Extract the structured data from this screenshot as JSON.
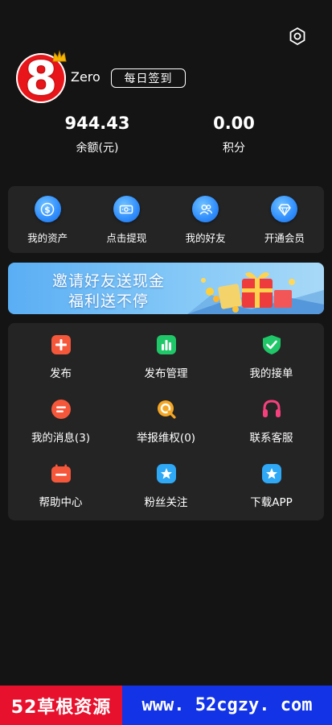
{
  "header": {
    "settings_icon": "settings-gear-icon",
    "avatar_digit": "8",
    "username": "Zero",
    "checkin_label": "每日签到"
  },
  "stats": {
    "balance_value": "944.43",
    "balance_label": "余额(元)",
    "points_value": "0.00",
    "points_label": "积分"
  },
  "quick_actions": [
    {
      "label": "我的资产",
      "icon": "dollar-coin-icon"
    },
    {
      "label": "点击提现",
      "icon": "cash-bill-icon"
    },
    {
      "label": "我的好友",
      "icon": "friends-icon"
    },
    {
      "label": "开通会员",
      "icon": "diamond-icon"
    }
  ],
  "banner": {
    "line1": "邀请好友送现金",
    "line2": "福利送不停"
  },
  "menu": [
    {
      "label": "发布",
      "icon": "plus-icon",
      "color": "#f5573b"
    },
    {
      "label": "发布管理",
      "icon": "bar-chart-icon",
      "color": "#1fc768"
    },
    {
      "label": "我的接单",
      "icon": "shield-check-icon",
      "color": "#1fc768"
    },
    {
      "label": "我的消息(3)",
      "icon": "message-icon",
      "color": "#f5573b"
    },
    {
      "label": "举报维权(0)",
      "icon": "search-report-icon",
      "color": "#f5a623"
    },
    {
      "label": "联系客服",
      "icon": "headset-icon",
      "color": "#f5407d"
    },
    {
      "label": "帮助中心",
      "icon": "calendar-help-icon",
      "color": "#f5573b"
    },
    {
      "label": "粉丝关注",
      "icon": "star-fan-icon",
      "color": "#2fa8f5"
    },
    {
      "label": "下载APP",
      "icon": "download-star-icon",
      "color": "#2fa8f5"
    }
  ],
  "footer": {
    "left_text": "52草根资源",
    "right_text": "www. 52cgzy. com"
  },
  "colors": {
    "background": "#141414",
    "card": "#242424",
    "accent_blue": "#2f8dfd",
    "brand_red": "#e8161a"
  }
}
